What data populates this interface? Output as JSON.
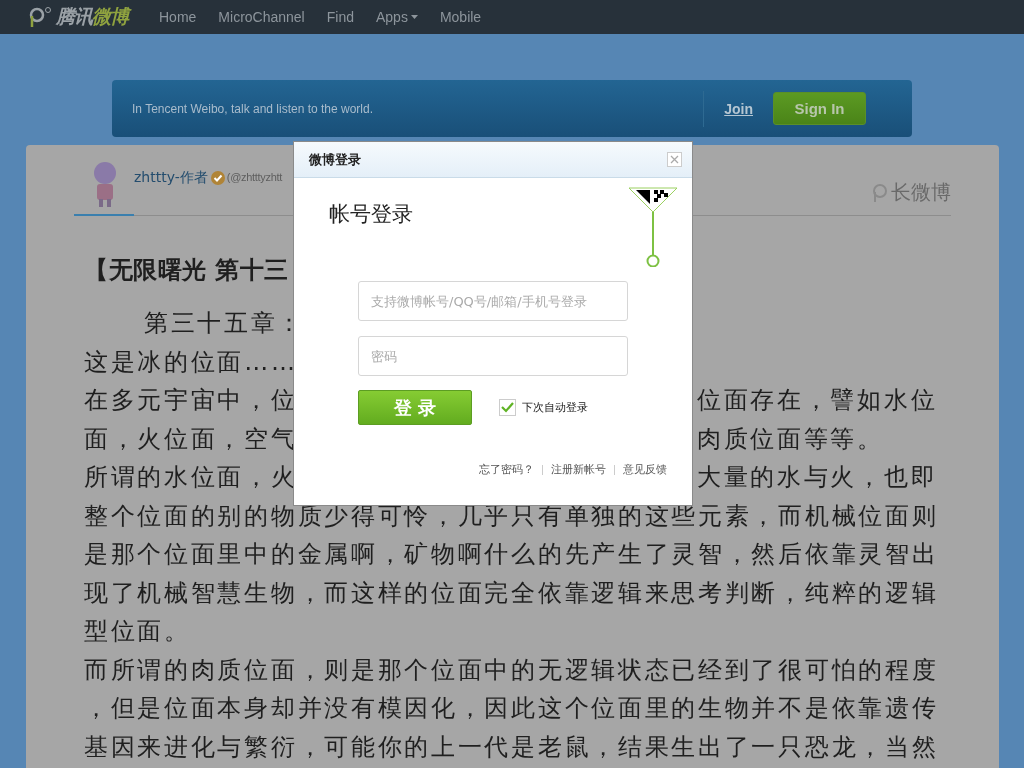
{
  "navbar": {
    "logo": {
      "first": "腾讯",
      "second": "微博"
    },
    "items": [
      {
        "label": "Home",
        "dropdown": false
      },
      {
        "label": "MicroChannel",
        "dropdown": false
      },
      {
        "label": "Find",
        "dropdown": false
      },
      {
        "label": "Apps",
        "dropdown": true
      },
      {
        "label": "Mobile",
        "dropdown": false
      }
    ]
  },
  "banner": {
    "tagline": "In Tencent Weibo, talk and listen to the world.",
    "join": "Join",
    "sign_in": "Sign In"
  },
  "post": {
    "author": "zhttty-作者",
    "verified": true,
    "handle": "(@zhtttyzhtt",
    "long_weibo": "长微博",
    "lines": [
      {
        "kind": "title",
        "left": "【无限曙光 第十三"
      },
      {
        "kind": "indent",
        "left": "第三十五章："
      },
      {
        "kind": "text",
        "left": "这是冰的位面……"
      },
      {
        "kind": "text",
        "left": "在多元宇宙中，位",
        "right": "位面存在，譬如水位"
      },
      {
        "kind": "text",
        "left": "面，火位面，空气",
        "right": "肉质位面等等。"
      },
      {
        "kind": "text",
        "left": "所谓的水位面，火",
        "right": "大量的水与火，也即"
      },
      {
        "kind": "text",
        "left": "整个位面的别的物质少得可怜，几乎只有单独的这些元素，而机械位面则"
      },
      {
        "kind": "text",
        "left": "是那个位面里中的金属啊，矿物啊什么的先产生了灵智，然后依靠灵智出"
      },
      {
        "kind": "text",
        "left": "现了机械智慧生物，而这样的位面完全依靠逻辑来思考判断，纯粹的逻辑"
      },
      {
        "kind": "text",
        "left": "型位面。"
      },
      {
        "kind": "text",
        "left": "而所谓的肉质位面，则是那个位面中的无逻辑状态已经到了很可怕的程度"
      },
      {
        "kind": "text",
        "left": "，但是位面本身却并没有模因化，因此这个位面里的生物并不是依靠遗传"
      },
      {
        "kind": "text",
        "left": "基因来进化与繁衍，可能你的上一代是老鼠，结果生出了一只恐龙，当然"
      }
    ]
  },
  "dialog": {
    "title": "微博登录",
    "heading": "帐号登录",
    "account": {
      "placeholder": "支持微博帐号/QQ号/邮箱/手机号登录"
    },
    "password": {
      "placeholder": "密码"
    },
    "submit": "登 录",
    "remember": {
      "label": "下次自动登录",
      "checked": true
    },
    "links": [
      "忘了密码？",
      "注册新帐号",
      "意见反馈"
    ]
  }
}
